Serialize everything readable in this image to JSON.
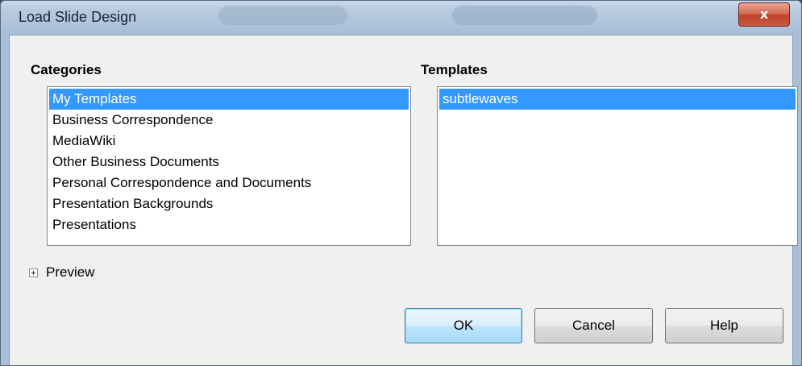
{
  "window": {
    "title": "Load Slide Design",
    "close_label": "x"
  },
  "categories": {
    "label": "Categories",
    "items": [
      "My Templates",
      "Business Correspondence",
      "MediaWiki",
      "Other Business Documents",
      "Personal Correspondence and Documents",
      "Presentation Backgrounds",
      "Presentations"
    ],
    "selected": "My Templates"
  },
  "templates": {
    "label": "Templates",
    "items": [
      "subtlewaves"
    ],
    "selected": "subtlewaves"
  },
  "preview": {
    "label": "Preview"
  },
  "buttons": {
    "ok": "OK",
    "cancel": "Cancel",
    "help": "Help"
  },
  "colors": {
    "selection": "#3399ff",
    "close_button": "#c0422b",
    "dialog_bg": "#f0f0f0"
  }
}
